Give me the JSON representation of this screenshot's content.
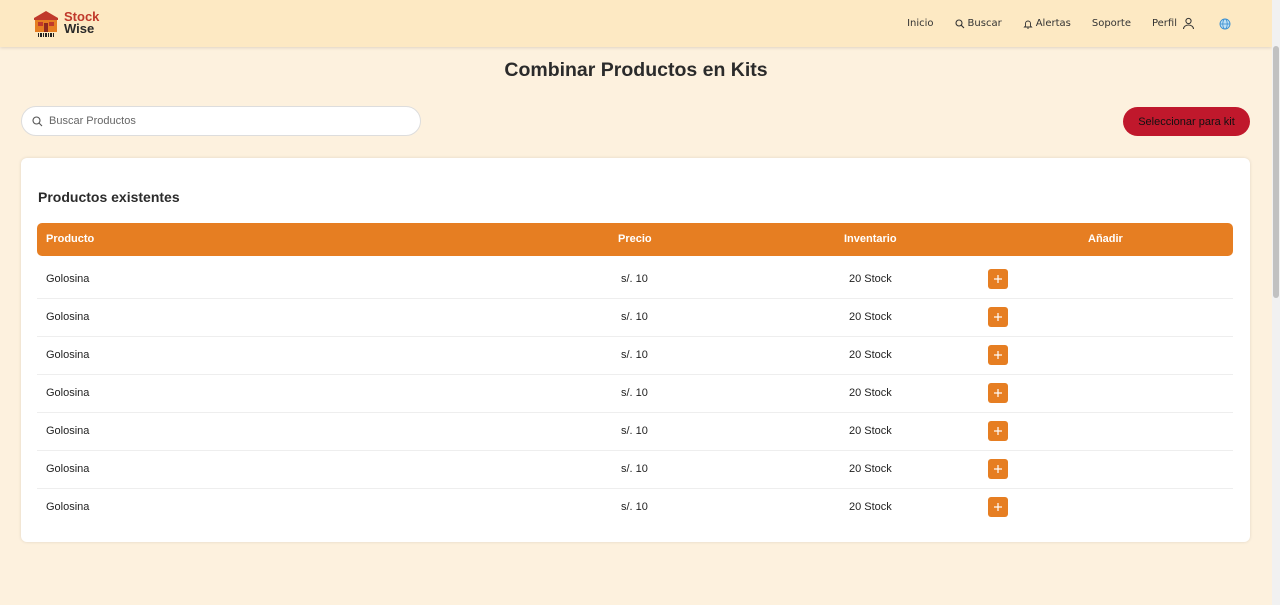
{
  "app": {
    "logo_line1": "Stock",
    "logo_line2": "Wise"
  },
  "nav": {
    "items": [
      {
        "label": "Inicio",
        "icon": ""
      },
      {
        "label": "Buscar",
        "icon": "search-icon"
      },
      {
        "label": "Alertas",
        "icon": "bell-icon"
      },
      {
        "label": "Soporte",
        "icon": ""
      },
      {
        "label": "Perfil",
        "icon": "user-icon"
      }
    ],
    "language_icon": "globe-icon"
  },
  "page": {
    "title": "Combinar Productos en Kits"
  },
  "search": {
    "placeholder": "Buscar Productos",
    "value": ""
  },
  "actions": {
    "select_kit_label": "Seleccionar para kit"
  },
  "table": {
    "title": "Productos existentes",
    "columns": [
      "Producto",
      "Precio",
      "Inventario",
      "Añadir"
    ],
    "rows": [
      {
        "product": "Golosina",
        "price": "s/. 10",
        "stock": "20 Stock"
      },
      {
        "product": "Golosina",
        "price": "s/. 10",
        "stock": "20 Stock"
      },
      {
        "product": "Golosina",
        "price": "s/. 10",
        "stock": "20 Stock"
      },
      {
        "product": "Golosina",
        "price": "s/. 10",
        "stock": "20 Stock"
      },
      {
        "product": "Golosina",
        "price": "s/. 10",
        "stock": "20 Stock"
      },
      {
        "product": "Golosina",
        "price": "s/. 10",
        "stock": "20 Stock"
      },
      {
        "product": "Golosina",
        "price": "s/. 10",
        "stock": "20 Stock"
      }
    ]
  },
  "colors": {
    "header_bg": "#fde9c3",
    "page_bg": "#fdf1de",
    "accent_orange": "#e67e22",
    "button_red": "#c0182c",
    "logo_red": "#c0392b"
  }
}
